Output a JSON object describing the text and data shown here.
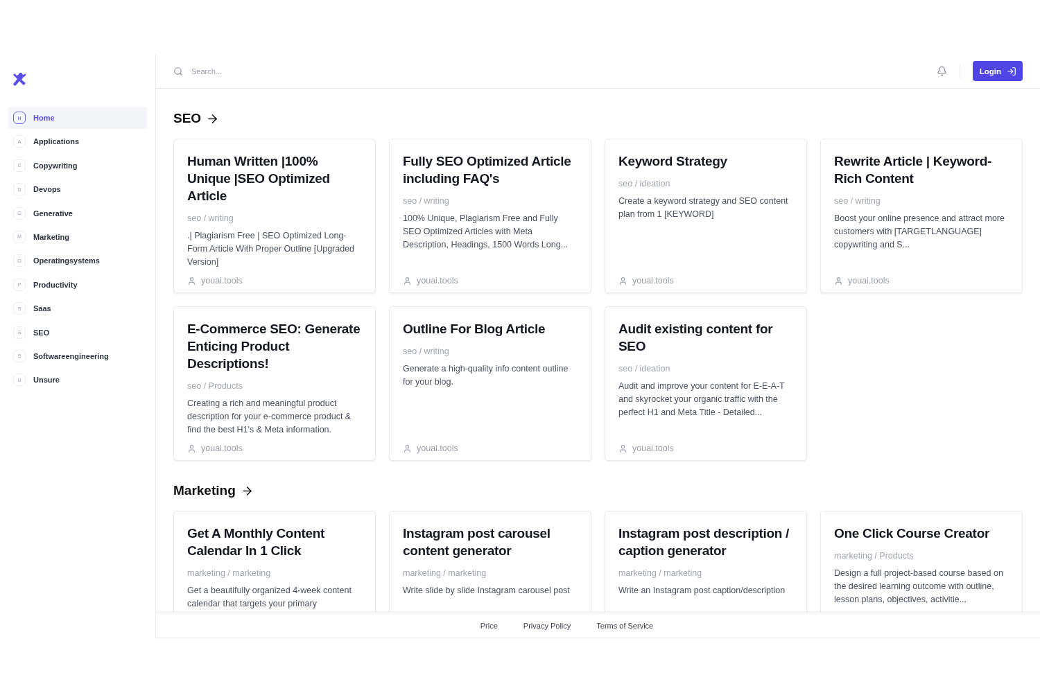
{
  "sidebar": {
    "items": [
      {
        "letter": "H",
        "label": "Home",
        "selected": true
      },
      {
        "letter": "A",
        "label": "Applications",
        "selected": false
      },
      {
        "letter": "C",
        "label": "Copywriting",
        "selected": false
      },
      {
        "letter": "D",
        "label": "Devops",
        "selected": false
      },
      {
        "letter": "G",
        "label": "Generative",
        "selected": false
      },
      {
        "letter": "M",
        "label": "Marketing",
        "selected": false
      },
      {
        "letter": "O",
        "label": "Operatingsystems",
        "selected": false
      },
      {
        "letter": "P",
        "label": "Productivity",
        "selected": false
      },
      {
        "letter": "S",
        "label": "Saas",
        "selected": false
      },
      {
        "letter": "S",
        "label": "SEO",
        "selected": false
      },
      {
        "letter": "S",
        "label": "Softwareengineering",
        "selected": false
      },
      {
        "letter": "U",
        "label": "Unsure",
        "selected": false
      }
    ]
  },
  "header": {
    "search": {
      "placeholder": "Search..."
    },
    "login_button": "Login"
  },
  "sections": [
    {
      "title": "SEO",
      "cards": [
        {
          "title": "Human Written |100% Unique |SEO Optimized Article",
          "category": "seo / writing",
          "description": ".| Plagiarism Free | SEO Optimized Long-Form Article With Proper Outline [Upgraded Version]",
          "author": "youai.tools"
        },
        {
          "title": "Fully SEO Optimized Article including FAQ's",
          "category": "seo / writing",
          "description": "100% Unique, Plagiarism Free and Fully SEO Optimized Articles with Meta Description, Headings, 1500 Words Long...",
          "author": "youai.tools"
        },
        {
          "title": "Keyword Strategy",
          "category": "seo / ideation",
          "description": "Create a keyword strategy and SEO content plan from 1 [KEYWORD]",
          "author": "youai.tools"
        },
        {
          "title": "Rewrite Article | Keyword-Rich Content",
          "category": "seo / writing",
          "description": "Boost your online presence and attract more customers with [TARGETLANGUAGE] copywriting and S...",
          "author": "youai.tools"
        },
        {
          "title": "E-Commerce SEO: Generate Enticing Product Descriptions!",
          "category": "seo / Products",
          "description": "Creating a rich and meaningful product description for your e-commerce product & find the best H1's & Meta information.",
          "author": "youai.tools"
        },
        {
          "title": "Outline For Blog Article",
          "category": "seo / writing",
          "description": "Generate a high-quality info content outline for your blog.",
          "author": "youai.tools"
        },
        {
          "title": "Audit existing content for SEO",
          "category": "seo / ideation",
          "description": "Audit and improve your content for E-E-A-T and skyrocket your organic traffic with the perfect H1 and Meta Title - Detailed...",
          "author": "youai.tools"
        }
      ]
    },
    {
      "title": "Marketing",
      "cards": [
        {
          "title": "Get A Monthly Content Calendar In 1 Click",
          "category": "marketing / marketing",
          "description": "Get a beautifully organized 4-week content calendar that targets your primary"
        },
        {
          "title": "Instagram post carousel content generator",
          "category": "marketing / marketing",
          "description": "Write slide by slide Instagram carousel post"
        },
        {
          "title": "Instagram post description / caption generator",
          "category": "marketing / marketing",
          "description": "Write an Instagram post caption/description"
        },
        {
          "title": "One Click Course Creator",
          "category": "marketing / Products",
          "description": "Design a full project-based course based on the desired learning outcome with outline, lesson plans, objectives, activitie..."
        }
      ]
    }
  ],
  "footer": {
    "links": [
      "Price",
      "Privacy Policy",
      "Terms of Service"
    ]
  }
}
